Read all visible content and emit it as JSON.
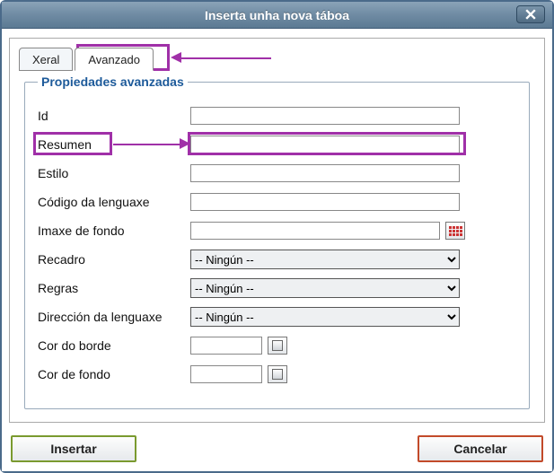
{
  "window": {
    "title": "Inserta unha nova táboa"
  },
  "tabs": {
    "general": "Xeral",
    "advanced": "Avanzado"
  },
  "fieldset": {
    "legend": "Propiedades avanzadas"
  },
  "labels": {
    "id": "Id",
    "summary": "Resumen",
    "style": "Estilo",
    "langcode": "Código da lenguaxe",
    "bgimage": "Imaxe de fondo",
    "frame": "Recadro",
    "rules": "Regras",
    "langdir": "Dirección da lenguaxe",
    "bordercolor": "Cor do borde",
    "bgcolor": "Cor de fondo"
  },
  "values": {
    "id": "",
    "summary": "",
    "style": "",
    "langcode": "",
    "bgimage": "",
    "bordercolor": "",
    "bgcolor": ""
  },
  "options": {
    "none": "-- Ningún --"
  },
  "buttons": {
    "insert": "Insertar",
    "cancel": "Cancelar"
  },
  "annotations": {
    "highlight_tab": "Avanzado",
    "highlight_field": "Resumen"
  }
}
